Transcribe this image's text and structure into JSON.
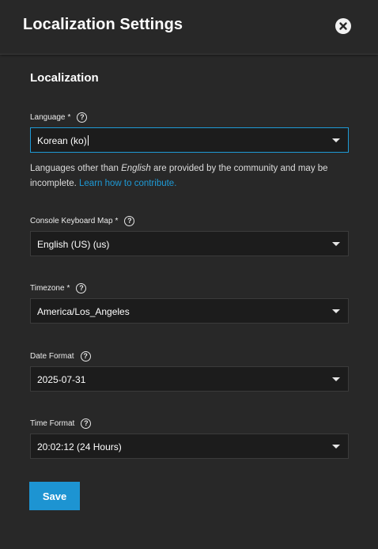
{
  "header": {
    "title": "Localization Settings",
    "close_icon": "close-icon"
  },
  "section": {
    "title": "Localization"
  },
  "fields": {
    "language": {
      "label": "Language",
      "required_mark": "*",
      "value": "Korean (ko)",
      "help_icon": "help-circle-icon"
    },
    "hint": {
      "part1": "Languages other than ",
      "emphasis": "English",
      "part2": " are provided by the community and may be incomplete. ",
      "link": "Learn how to contribute."
    },
    "keyboard_map": {
      "label": "Console Keyboard Map",
      "required_mark": "*",
      "value": "English (US) (us)",
      "help_icon": "help-circle-icon"
    },
    "timezone": {
      "label": "Timezone",
      "required_mark": "*",
      "value": "America/Los_Angeles",
      "help_icon": "help-circle-icon"
    },
    "date_format": {
      "label": "Date Format",
      "value": "2025-07-31",
      "help_icon": "help-circle-icon"
    },
    "time_format": {
      "label": "Time Format",
      "value": "20:02:12 (24 Hours)",
      "help_icon": "help-circle-icon"
    }
  },
  "actions": {
    "save_label": "Save"
  },
  "colors": {
    "background": "#282828",
    "input_bg": "#1c1c1c",
    "accent": "#1e9ad6",
    "button": "#1d94d2"
  }
}
